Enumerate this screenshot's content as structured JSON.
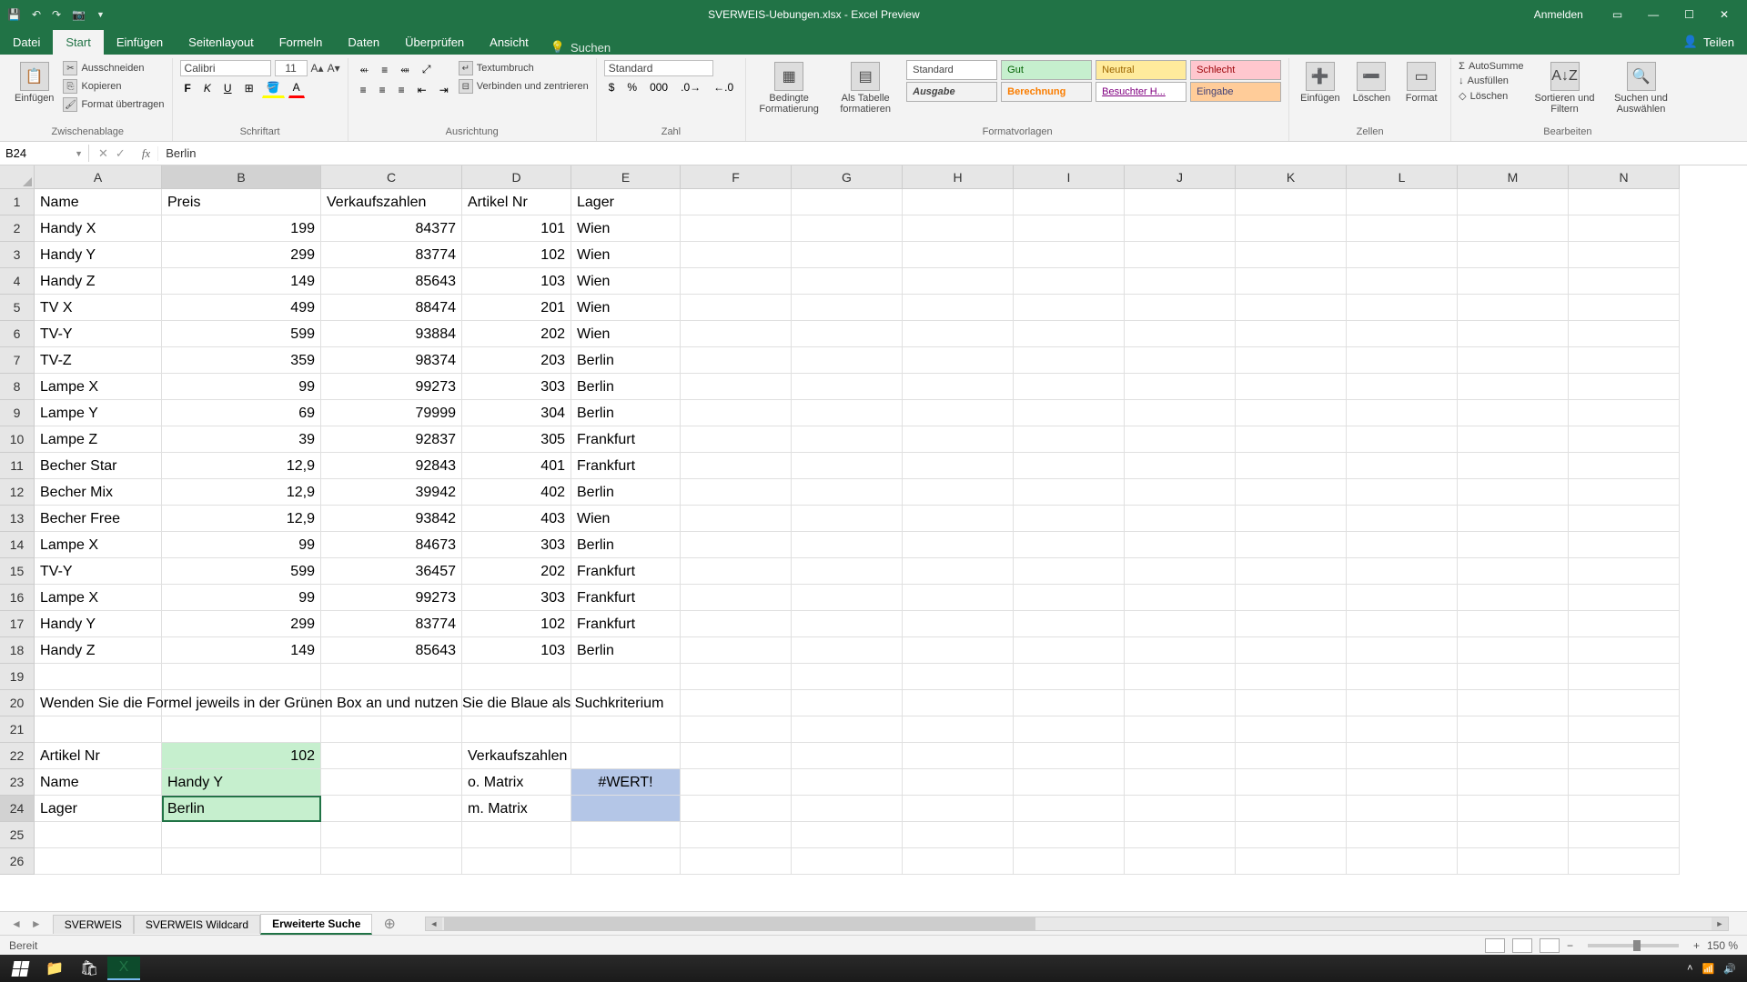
{
  "title_bar": {
    "filename": "SVERWEIS-Uebungen.xlsx - Excel Preview",
    "signin": "Anmelden"
  },
  "ribbon_tabs": {
    "file": "Datei",
    "tabs": [
      "Start",
      "Einfügen",
      "Seitenlayout",
      "Formeln",
      "Daten",
      "Überprüfen",
      "Ansicht"
    ],
    "active_index": 0,
    "tell_me": "Suchen",
    "share": "Teilen"
  },
  "ribbon": {
    "clipboard": {
      "paste": "Einfügen",
      "cut": "Ausschneiden",
      "copy": "Kopieren",
      "format_painter": "Format übertragen",
      "label": "Zwischenablage"
    },
    "font": {
      "name": "Calibri",
      "size": "11",
      "label": "Schriftart"
    },
    "alignment": {
      "wrap": "Textumbruch",
      "merge": "Verbinden und zentrieren",
      "label": "Ausrichtung"
    },
    "number": {
      "format": "Standard",
      "label": "Zahl"
    },
    "styles": {
      "cond_format": "Bedingte Formatierung",
      "table": "Als Tabelle formatieren",
      "standard": "Standard",
      "gut": "Gut",
      "neutral": "Neutral",
      "schlecht": "Schlecht",
      "ausgabe": "Ausgabe",
      "berechnung": "Berechnung",
      "besucht": "Besuchter H...",
      "eingabe": "Eingabe",
      "label": "Formatvorlagen"
    },
    "cells": {
      "insert": "Einfügen",
      "delete": "Löschen",
      "format": "Format",
      "label": "Zellen"
    },
    "editing": {
      "autosum": "AutoSumme",
      "fill": "Ausfüllen",
      "clear": "Löschen",
      "sort": "Sortieren und Filtern",
      "find": "Suchen und Auswählen",
      "label": "Bearbeiten"
    }
  },
  "name_box": "B24",
  "formula_value": "Berlin",
  "columns": [
    "A",
    "B",
    "C",
    "D",
    "E",
    "F",
    "G",
    "H",
    "I",
    "J",
    "K",
    "L",
    "M",
    "N"
  ],
  "headers": [
    "Name",
    "Preis",
    "Verkaufszahlen",
    "Artikel Nr",
    "Lager"
  ],
  "rows": [
    [
      "Handy X",
      "199",
      "84377",
      "101",
      "Wien"
    ],
    [
      "Handy Y",
      "299",
      "83774",
      "102",
      "Wien"
    ],
    [
      "Handy Z",
      "149",
      "85643",
      "103",
      "Wien"
    ],
    [
      "TV X",
      "499",
      "88474",
      "201",
      "Wien"
    ],
    [
      "TV-Y",
      "599",
      "93884",
      "202",
      "Wien"
    ],
    [
      "TV-Z",
      "359",
      "98374",
      "203",
      "Berlin"
    ],
    [
      "Lampe X",
      "99",
      "99273",
      "303",
      "Berlin"
    ],
    [
      "Lampe Y",
      "69",
      "79999",
      "304",
      "Berlin"
    ],
    [
      "Lampe Z",
      "39",
      "92837",
      "305",
      "Frankfurt"
    ],
    [
      "Becher Star",
      "12,9",
      "92843",
      "401",
      "Frankfurt"
    ],
    [
      "Becher Mix",
      "12,9",
      "39942",
      "402",
      "Berlin"
    ],
    [
      "Becher Free",
      "12,9",
      "93842",
      "403",
      "Wien"
    ],
    [
      "Lampe X",
      "99",
      "84673",
      "303",
      "Berlin"
    ],
    [
      "TV-Y",
      "599",
      "36457",
      "202",
      "Frankfurt"
    ],
    [
      "Lampe X",
      "99",
      "99273",
      "303",
      "Frankfurt"
    ],
    [
      "Handy Y",
      "299",
      "83774",
      "102",
      "Frankfurt"
    ],
    [
      "Handy Z",
      "149",
      "85643",
      "103",
      "Berlin"
    ]
  ],
  "instruction_row": "Wenden Sie die Formel jeweils in der Grünen Box an und nutzen Sie die Blaue als Suchkriterium",
  "lookup_block": {
    "r22": {
      "a": "Artikel Nr",
      "b": "102",
      "d": "Verkaufszahlen"
    },
    "r23": {
      "a": "Name",
      "b": "Handy Y",
      "d": "o. Matrix",
      "e": "#WERT!"
    },
    "r24": {
      "a": "Lager",
      "b": "Berlin",
      "d": "m. Matrix"
    }
  },
  "sheet_tabs": [
    "SVERWEIS",
    "SVERWEIS Wildcard",
    "Erweiterte Suche"
  ],
  "active_sheet": 2,
  "status": {
    "ready": "Bereit",
    "zoom": "150 %"
  }
}
